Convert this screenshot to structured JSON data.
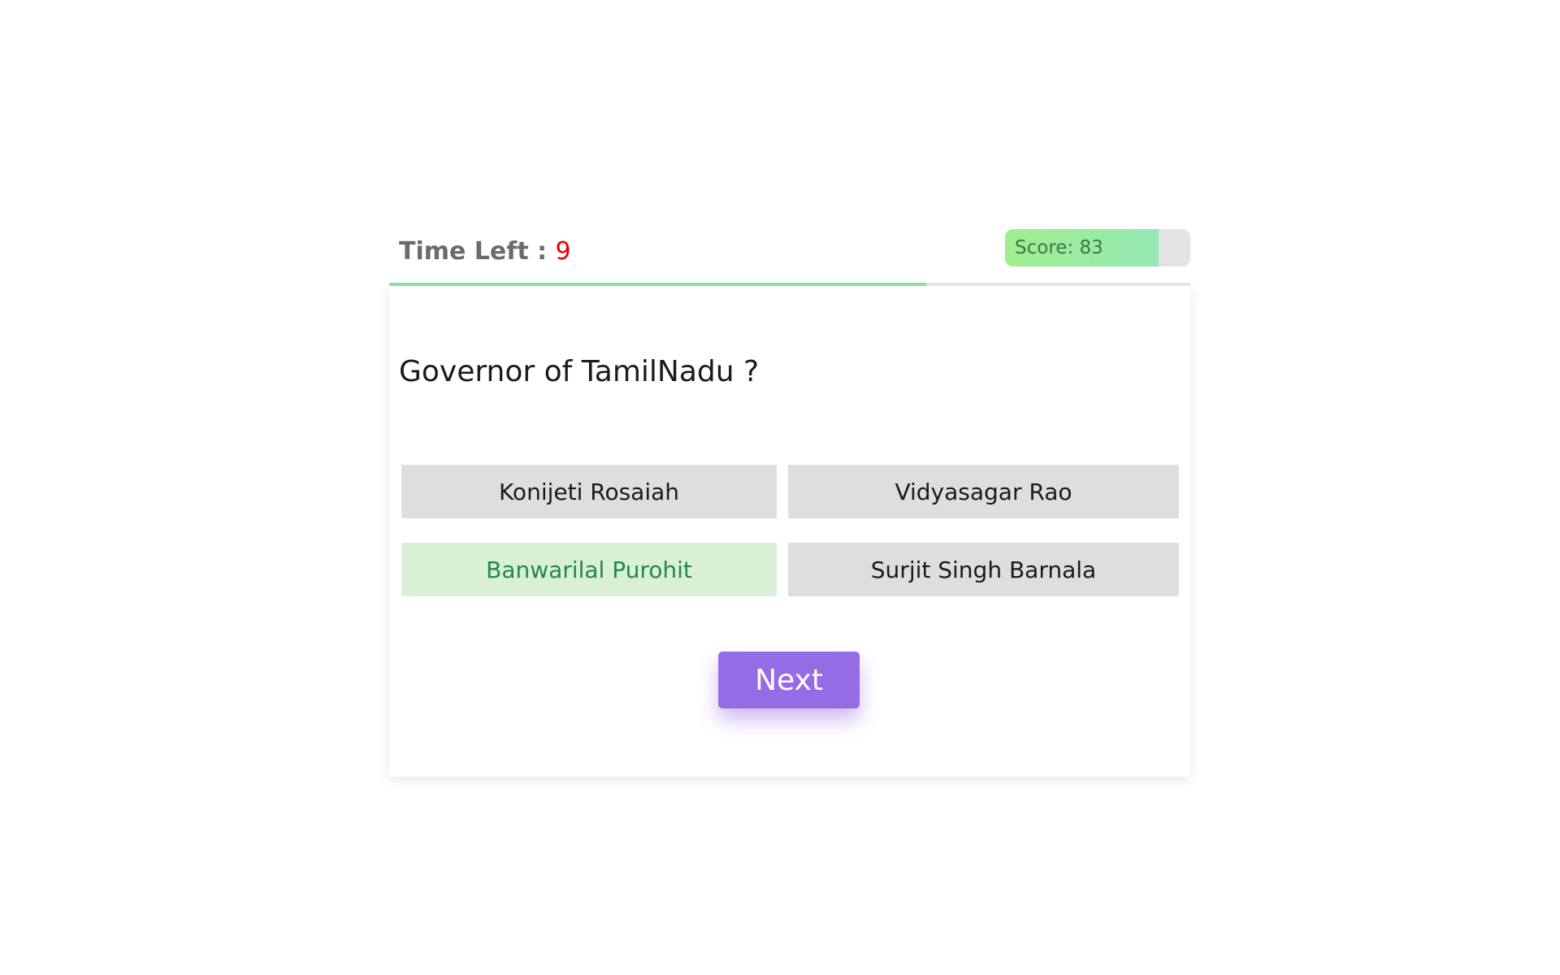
{
  "header": {
    "time_label": "Time Left : ",
    "time_value": "9",
    "time_fraction_remaining": 0.67,
    "score_label": "Score: ",
    "score_value": "83",
    "score_percent": 83
  },
  "question": {
    "text": "Governor of TamilNadu ?"
  },
  "options": [
    {
      "label": "Konijeti Rosaiah",
      "state": "default"
    },
    {
      "label": "Vidyasagar Rao",
      "state": "default"
    },
    {
      "label": "Banwarilal Purohit",
      "state": "correct"
    },
    {
      "label": "Surjit Singh Barnala",
      "state": "default"
    }
  ],
  "actions": {
    "next_label": "Next"
  },
  "colors": {
    "time_value": "#e60000",
    "correct_bg": "#daf0d6",
    "correct_text": "#1f8a4a",
    "next_button": "#966be6",
    "score_fill": "#a0ee8f",
    "timer_fill": "#8fe3a6"
  }
}
